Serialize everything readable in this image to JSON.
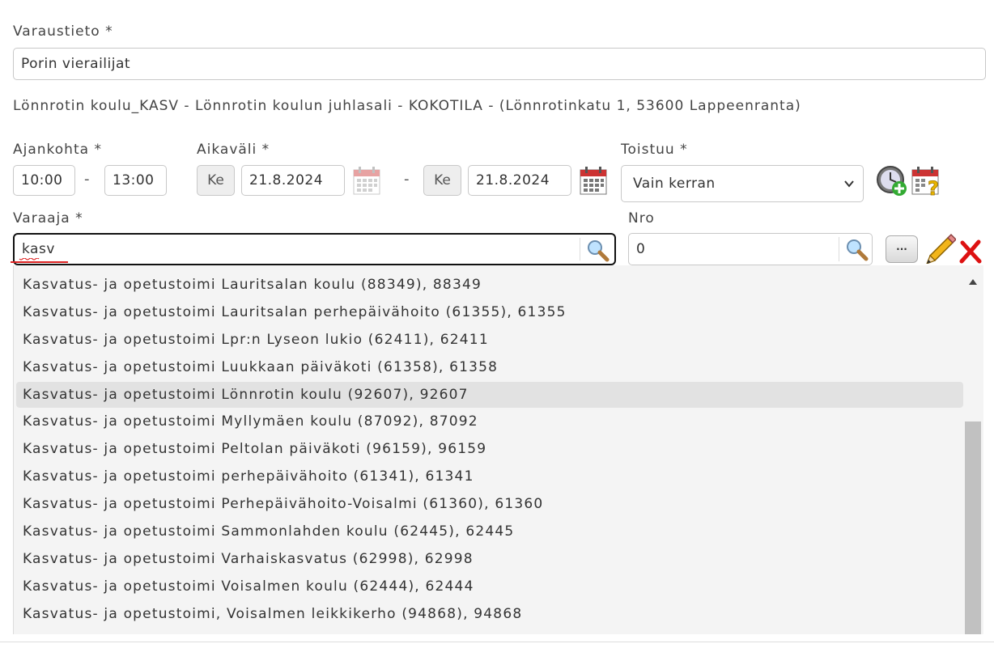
{
  "varaustieto": {
    "label": "Varaustieto *",
    "value": "Porin vierailijat"
  },
  "location_info": "Lönnrotin koulu_KASV - Lönnrotin koulun juhlasali - KOKOTILA - (Lönnrotinkatu 1, 53600 Lappeenranta)",
  "ajankohta": {
    "label": "Ajankohta *",
    "start": "10:00",
    "separator": "-",
    "end": "13:00"
  },
  "aikavali": {
    "label": "Aikaväli *",
    "start_day": "Ke",
    "start_date": "21.8.2024",
    "separator": "-",
    "end_day": "Ke",
    "end_date": "21.8.2024"
  },
  "toistuu": {
    "label": "Toistuu *",
    "selected": "Vain kerran"
  },
  "varaaja": {
    "label": "Varaaja *",
    "value": "kasv"
  },
  "nro": {
    "label": "Nro",
    "value": "0",
    "more_button": "···"
  },
  "dropdown_items": [
    "Kasvatus- ja opetustoimi Lauritsalan koulu (88349), 88349",
    "Kasvatus- ja opetustoimi Lauritsalan perhepäivähoito (61355), 61355",
    "Kasvatus- ja opetustoimi Lpr:n Lyseon lukio (62411), 62411",
    "Kasvatus- ja opetustoimi Luukkaan päiväkoti (61358), 61358",
    "Kasvatus- ja opetustoimi Lönnrotin koulu (92607), 92607",
    "Kasvatus- ja opetustoimi Myllymäen koulu (87092), 87092",
    "Kasvatus- ja opetustoimi Peltolan päiväkoti (96159), 96159",
    "Kasvatus- ja opetustoimi perhepäivähoito (61341), 61341",
    "Kasvatus- ja opetustoimi Perhepäivähoito-Voisalmi (61360), 61360",
    "Kasvatus- ja opetustoimi Sammonlahden koulu (62445), 62445",
    "Kasvatus- ja opetustoimi Varhaiskasvatus (62998), 62998",
    "Kasvatus- ja opetustoimi Voisalmen koulu (62444), 62444",
    "Kasvatus- ja opetustoimi, Voisalmen leikkikerho (94868), 94868"
  ],
  "highlighted_item": "Kasvatus- ja opetustoimi Lönnrotin koulu (92607), 92607",
  "icons": {
    "calendar": "calendar-icon",
    "clock_add": "clock-add-icon",
    "calendar_help": "calendar-help-icon",
    "search": "magnifier-icon",
    "edit": "pencil-icon",
    "delete": "red-x-icon"
  }
}
